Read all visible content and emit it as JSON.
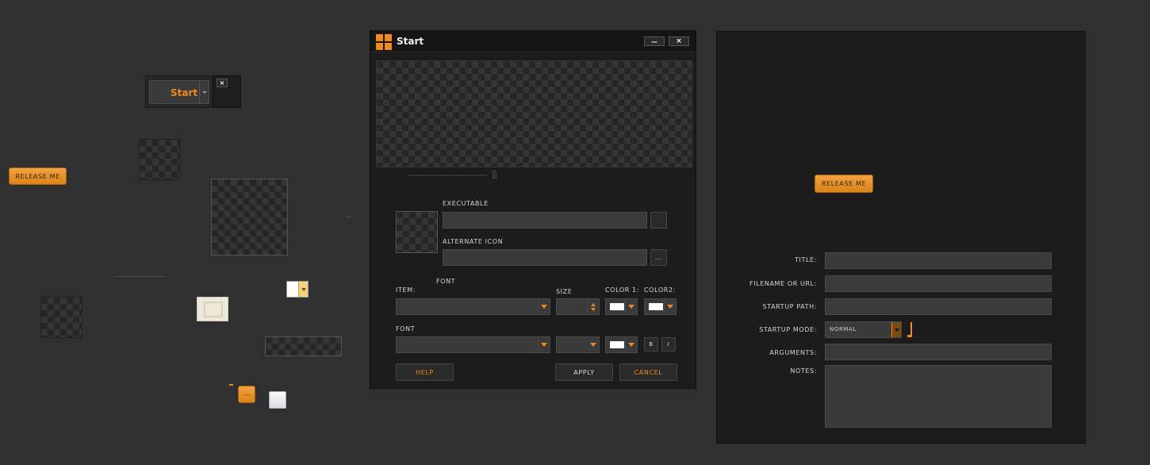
{
  "colors": {
    "accent": "#f08a1c",
    "background": "#303030",
    "panel": "#1c1c1c"
  },
  "floating": {
    "start_button_label": "Start",
    "close_glyph": "×",
    "release_label": "RELEASE ME"
  },
  "dialog": {
    "title": "Start",
    "minimize_glyph": "—",
    "close_glyph": "×",
    "executable_label": "EXECUTABLE",
    "alternate_icon_label": "ALTERNATE ICON",
    "browse_label": "...",
    "item_label": "ITEM:",
    "font_label": "FONT",
    "size_label": "SIZE",
    "color1_label": "COLOR 1:",
    "color2_label": "COLOR2:",
    "font2_label": "FONT",
    "bold_label": "B",
    "italic_label": "I",
    "help_label": "HELP",
    "apply_label": "APPLY",
    "cancel_label": "CANCEL"
  },
  "right_panel": {
    "release_label": "RELEASE ME",
    "title_label": "TITLE:",
    "filename_label": "FILENAME OR URL:",
    "startup_path_label": "STARTUP PATH:",
    "startup_mode_label": "STARTUP MODE:",
    "startup_mode_value": "NORMAL",
    "arguments_label": "ARGUMENTS:",
    "notes_label": "NOTES:"
  }
}
